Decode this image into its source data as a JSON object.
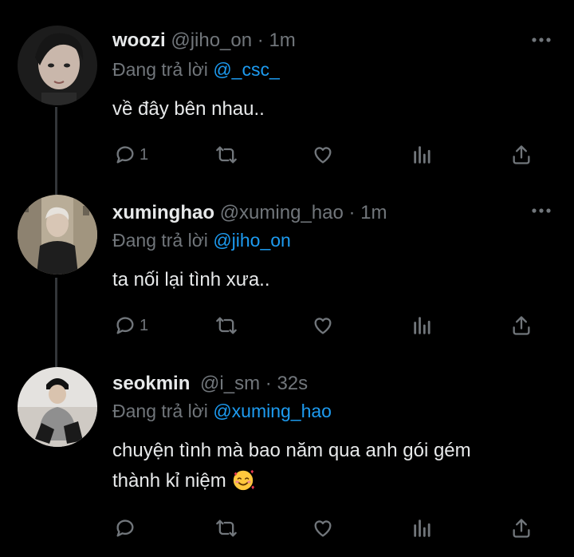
{
  "tweets": [
    {
      "name": "woozi",
      "handle": "@jiho_on",
      "dot": "·",
      "time": "1m",
      "reply_prefix": "Đang trả lời",
      "reply_to": "@_csc_",
      "text": "về đây bên nhau..",
      "reply_count": "1"
    },
    {
      "name": "xuminghao",
      "handle": "@xuming_hao",
      "dot": "·",
      "time": "1m",
      "reply_prefix": "Đang trả lời",
      "reply_to": "@jiho_on",
      "text": "ta nối lại tình xưa..",
      "reply_count": "1"
    },
    {
      "name": "seokmin",
      "handle": "@i_sm",
      "dot": "·",
      "time": "32s",
      "reply_prefix": "Đang trả lời",
      "reply_to": "@xuming_hao",
      "text_line1": "chuyện tình mà bao năm qua anh gói gém",
      "text_line2": "thành kỉ niệm",
      "reply_count": ""
    }
  ],
  "icons": {
    "reply": "reply-icon",
    "retweet": "retweet-icon",
    "like": "heart-icon",
    "views": "views-icon",
    "share": "share-icon",
    "more": "more-icon",
    "emoji": "smiling-face-with-hearts-emoji"
  },
  "colors": {
    "background": "#000000",
    "text": "#e7e9ea",
    "muted": "#71767b",
    "link": "#1d9bf0",
    "thread_line": "#333639"
  }
}
